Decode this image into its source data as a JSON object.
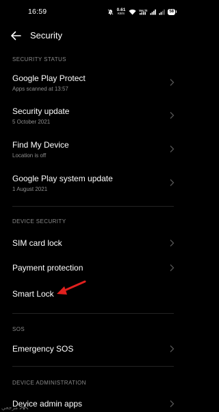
{
  "status_bar": {
    "time": "16:59",
    "speed_value": "0.61",
    "speed_unit": "KB/S",
    "battery": "58"
  },
  "header": {
    "title": "Security",
    "back_icon": "arrow-left-icon"
  },
  "sections": {
    "security_status": "SECURITY STATUS",
    "device_security": "DEVICE SECURITY",
    "sos": "SOS",
    "device_admin": "DEVICE ADMINISTRATION"
  },
  "items": {
    "google_play_protect": {
      "title": "Google Play Protect",
      "subtitle": "Apps scanned at 13:57"
    },
    "security_update": {
      "title": "Security update",
      "subtitle": "5 October 2021"
    },
    "find_my_device": {
      "title": "Find My Device",
      "subtitle": "Location is off"
    },
    "play_system_update": {
      "title": "Google Play system update",
      "subtitle": "1 August 2021"
    },
    "sim_card_lock": {
      "title": "SIM card lock"
    },
    "payment_protection": {
      "title": "Payment protection"
    },
    "smart_lock": {
      "title": "Smart Lock"
    },
    "emergency_sos": {
      "title": "Emergency SOS"
    },
    "device_admin_apps": {
      "title": "Device admin apps"
    }
  },
  "annotation": {
    "color": "#e0201e",
    "icon": "red-arrow-icon"
  },
  "watermark": {
    "text": "مرجعي"
  }
}
